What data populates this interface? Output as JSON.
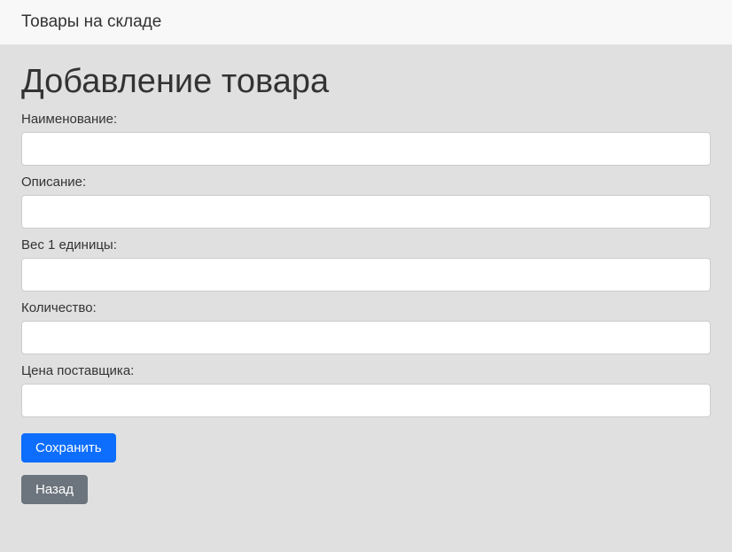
{
  "navbar": {
    "brand": "Товары на складе"
  },
  "page": {
    "title": "Добавление товара"
  },
  "form": {
    "fields": {
      "name": {
        "label": "Наименование:",
        "value": ""
      },
      "description": {
        "label": "Описание:",
        "value": ""
      },
      "weight": {
        "label": "Вес 1 единицы:",
        "value": ""
      },
      "quantity": {
        "label": "Количество:",
        "value": ""
      },
      "supplier_price": {
        "label": "Цена поставщика:",
        "value": ""
      }
    },
    "buttons": {
      "save": "Сохранить",
      "back": "Назад"
    }
  }
}
